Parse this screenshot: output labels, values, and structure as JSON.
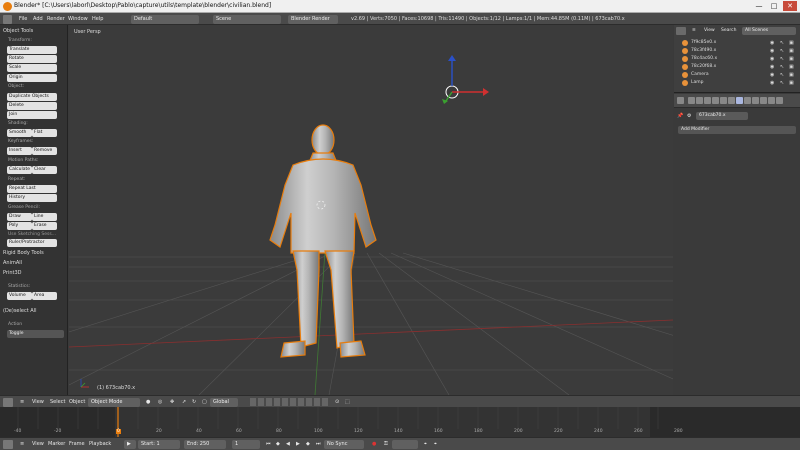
{
  "window": {
    "title": "Blender* [C:\\Users\\laborl\\Desktop\\Pablo\\capture\\utils\\template\\blender\\civilian.blend]",
    "controls": [
      "—",
      "□",
      "✕"
    ]
  },
  "info_header": {
    "menus": [
      "File",
      "Add",
      "Render",
      "Window",
      "Help"
    ],
    "screen_layout": "Default",
    "scene": "Scene",
    "render_engine": "Blender Render",
    "stats": "v2.69 | Verts:7050 | Faces:10698 | Tris:11490 | Objects:1/12 | Lamps:1/1 | Mem:44.85M (0.11M) | 673cab70.x"
  },
  "tool_shelf": {
    "object_tools_title": "Object Tools",
    "transform_label": "Transform:",
    "translate": "Translate",
    "rotate": "Rotate",
    "scale": "Scale",
    "origin": "Origin",
    "object_label": "Object:",
    "duplicate_objects": "Duplicate Objects",
    "delete": "Delete",
    "join": "Join",
    "shading_label": "Shading:",
    "smooth": "Smooth",
    "flat": "Flat",
    "keyframes_label": "Keyframes:",
    "insert": "Insert",
    "remove": "Remove",
    "motion_paths_label": "Motion Paths:",
    "calculate": "Calculate",
    "clear": "Clear",
    "repeat_label": "Repeat:",
    "repeat_last": "Repeat Last",
    "history": "History",
    "grease_pencil_label": "Grease Pencil:",
    "draw": "Draw",
    "line": "Line",
    "poly": "Poly",
    "erase": "Erase",
    "use_sketching_sessions": "Use Sketching Sess...",
    "ruler_protractor": "Ruler/Protractor",
    "rigid_body_tools": "Rigid Body Tools",
    "animall": "AnimAll",
    "print3d": "Print3D",
    "statistics_label": "Statistics:",
    "volume": "Volume",
    "area": "Area",
    "deselect_all": "(De)select All",
    "action_label": "Action",
    "action_value": "Toggle"
  },
  "viewport": {
    "view_name": "User Persp",
    "object_label": "(1) 673cab70.x"
  },
  "outliner": {
    "view_menu": "View",
    "search_menu": "Search",
    "scenes_dropdown": "All Scenes",
    "items": [
      {
        "name": "7f9c85e0.x"
      },
      {
        "name": "78c3f490.x"
      },
      {
        "name": "78c4ac60.x"
      },
      {
        "name": "78c20f68.x"
      },
      {
        "name": "Camera"
      },
      {
        "name": "Lamp"
      }
    ]
  },
  "properties": {
    "object_name": "673cab70.x",
    "add_modifier": "Add Modifier"
  },
  "view3d_header": {
    "view": "View",
    "select": "Select",
    "object": "Object",
    "mode": "Object Mode",
    "orientation": "Global"
  },
  "timeline": {
    "ticks": [
      "-40",
      "-20",
      "0",
      "20",
      "40",
      "60",
      "80",
      "100",
      "120",
      "140",
      "160",
      "180",
      "200",
      "220",
      "240",
      "260",
      "280"
    ],
    "current_frame": 1,
    "view": "View",
    "marker": "Marker",
    "frame": "Frame",
    "playback": "Playback",
    "start_label": "Start: 1",
    "end_label": "End: 250",
    "current": "1",
    "sync": "No Sync"
  },
  "colors": {
    "selection_outline": "#e87d0d",
    "axis_x": "#d03030",
    "axis_y": "#3aa030",
    "axis_z": "#2a50c8",
    "playhead": "#e87d0d"
  }
}
